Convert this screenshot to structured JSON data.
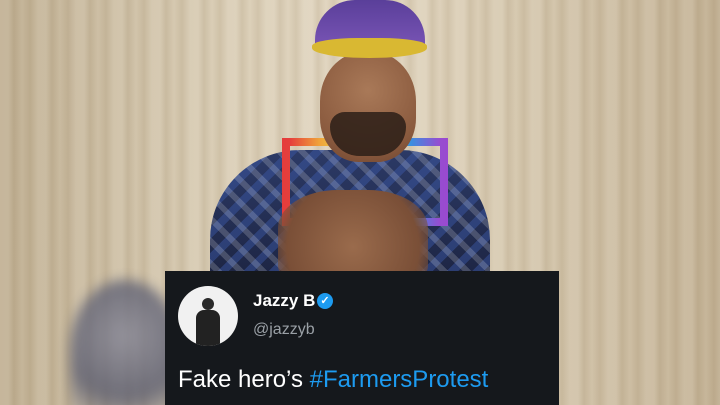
{
  "tweet": {
    "name": "Jazzy B",
    "handle": "@jazzyb",
    "text_prefix": "Fake hero’s ",
    "hashtag": "#FarmersProtest",
    "verified_icon": "verified-badge-icon",
    "verified_glyph": "✓",
    "accent_color": "#1d9bf0",
    "background_color": "#15181c"
  }
}
